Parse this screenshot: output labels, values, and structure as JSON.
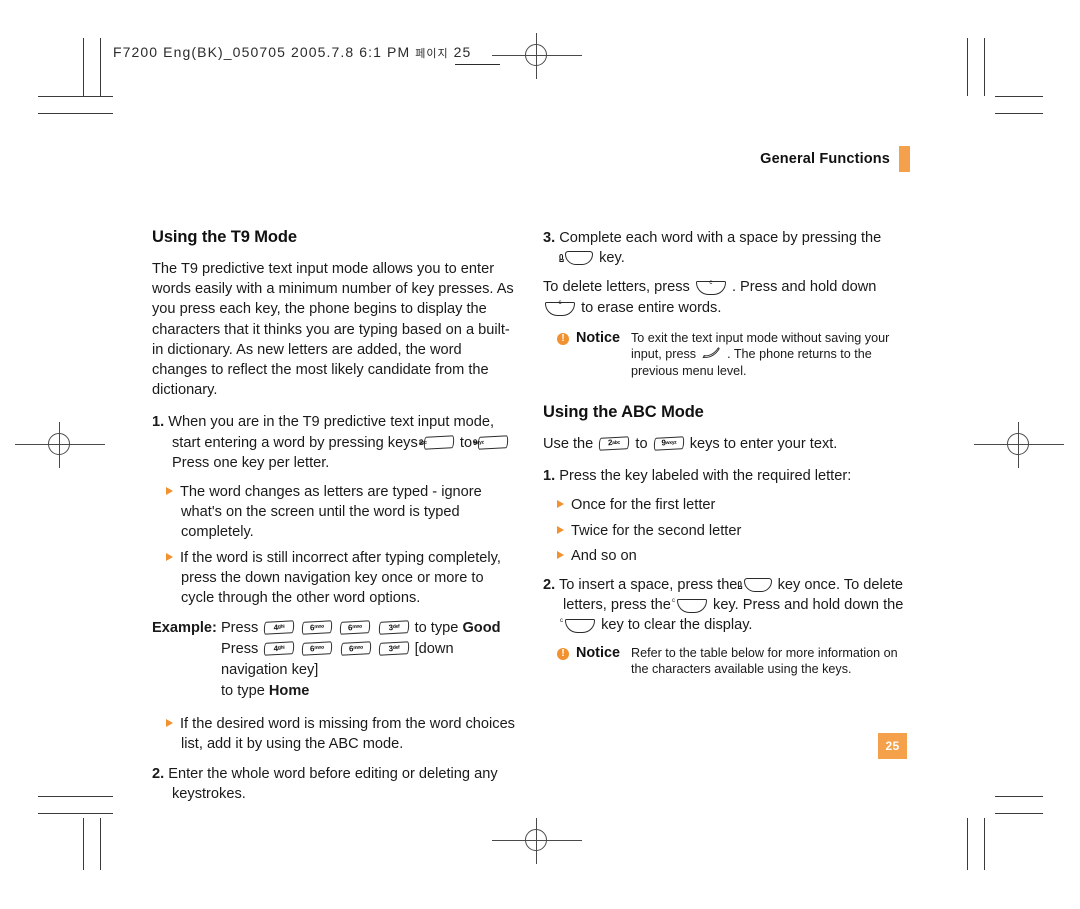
{
  "print_marks": {
    "file_stamp": "F7200 Eng(BK)_050705  2005.7.8  6:1 PM",
    "file_stamp_han": "페이지",
    "file_stamp_page": "25"
  },
  "running_head": {
    "title": "General Functions"
  },
  "page_number": "25",
  "colors": {
    "accent_orange": "#F5A04A",
    "bullet_orange": "#F2912F",
    "text": "#1a1a1a"
  },
  "left_column": {
    "heading": "Using the T9 Mode",
    "intro": "The T9 predictive text input mode allows you to enter words easily with a minimum number of key presses. As you press each key, the phone begins to display the characters that it thinks you are typing based on a built-in dictionary. As new letters are added, the word changes to reflect the most likely candidate from the dictionary.",
    "step1": {
      "number": "1.",
      "text_a": "When you are in the T9 predictive text input mode, start entering a word by pressing keys",
      "key_from": {
        "digit": "2",
        "letters": "abc"
      },
      "text_b": "to",
      "key_to": {
        "digit": "9",
        "letters": "wxyz"
      },
      "text_c": "Press one key per letter."
    },
    "bullets_after_step1": [
      "The word changes as letters are typed - ignore what's on the screen until the word is typed completely.",
      "If the word is still incorrect after typing completely, press the down navigation key once or more to cycle through the other word options."
    ],
    "example": {
      "label": "Example:",
      "line1_press": "Press",
      "line1_keys": [
        {
          "digit": "4",
          "letters": "ghi"
        },
        {
          "digit": "6",
          "letters": "mno"
        },
        {
          "digit": "6",
          "letters": "mno"
        },
        {
          "digit": "3",
          "letters": "def"
        }
      ],
      "line1_tail": "to type",
      "line1_word": "Good",
      "line2_press": "Press",
      "line2_keys": [
        {
          "digit": "4",
          "letters": "ghi"
        },
        {
          "digit": "6",
          "letters": "mno"
        },
        {
          "digit": "6",
          "letters": "mno"
        },
        {
          "digit": "3",
          "letters": "def"
        }
      ],
      "line2_tail": "[down navigation key]",
      "line3_tail": "to type",
      "line3_word": "Home"
    },
    "bullet_after_example": "If the desired word is missing from the word choices list, add it by using the ABC mode.",
    "step2": {
      "number": "2.",
      "text": "Enter the whole word before editing or deleting any keystrokes."
    }
  },
  "right_column": {
    "step3": {
      "number": "3.",
      "text_a": "Complete each word with a space by pressing the",
      "key_zero": {
        "digit": "0",
        "symbol": "␣"
      },
      "text_b": "key."
    },
    "delete_para": {
      "text_a": "To delete letters, press",
      "text_b": ". Press and hold down",
      "text_c": "to erase entire words."
    },
    "notice1": {
      "label": "Notice",
      "text_a": "To exit the text input mode without saving your input, press",
      "text_b": ". The phone returns to the previous menu level."
    },
    "heading": "Using the ABC Mode",
    "intro": {
      "text_a": "Use the",
      "key_from": {
        "digit": "2",
        "letters": "abc"
      },
      "text_b": "to",
      "key_to": {
        "digit": "9",
        "letters": "wxyz"
      },
      "text_c": "keys to enter your text."
    },
    "step1": {
      "number": "1.",
      "text": "Press the key labeled with the required letter:"
    },
    "bullets": [
      "Once for the first letter",
      "Twice for the second letter",
      "And so on"
    ],
    "step2": {
      "number": "2.",
      "text_a": "To insert a space, press the",
      "key_zero": {
        "digit": "0",
        "symbol": "␣"
      },
      "text_b": "key once. To delete letters, press the",
      "text_c": "key. Press and hold down the",
      "text_d": "key to clear the display."
    },
    "notice2": {
      "label": "Notice",
      "text": "Refer to the table below for more information on the characters available using the keys."
    }
  }
}
